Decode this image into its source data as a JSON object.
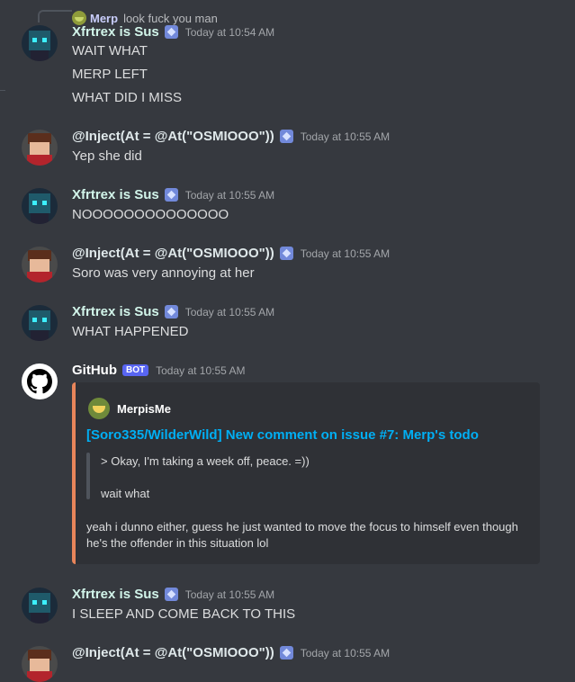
{
  "reply": {
    "author": "Merp",
    "text": "look fuck you man"
  },
  "messages": [
    {
      "author": "Xfrtrex is Sus",
      "time": "Today at 10:54 AM",
      "lines": [
        "WAIT WHAT",
        "MERP LEFT",
        "WHAT DID I MISS"
      ]
    },
    {
      "author": "@Inject(At = @At(\"OSMIOOO\"))",
      "time": "Today at 10:55 AM",
      "lines": [
        "Yep she did"
      ]
    },
    {
      "author": "Xfrtrex is Sus",
      "time": "Today at 10:55 AM",
      "lines": [
        "NOOOOOOOOOOOOOO"
      ]
    },
    {
      "author": "@Inject(At = @At(\"OSMIOOO\"))",
      "time": "Today at 10:55 AM",
      "lines": [
        "Soro was very annoying at her"
      ]
    },
    {
      "author": "Xfrtrex is Sus",
      "time": "Today at 10:55 AM",
      "lines": [
        "WHAT HAPPENED"
      ]
    },
    {
      "author": "GitHub",
      "badge": "BOT",
      "time": "Today at 10:55 AM"
    },
    {
      "author": "Xfrtrex is Sus",
      "time": "Today at 10:55 AM",
      "lines": [
        "I SLEEP AND COME BACK TO THIS"
      ]
    },
    {
      "author": "@Inject(At = @At(\"OSMIOOO\"))",
      "time": "Today at 10:55 AM"
    }
  ],
  "embed": {
    "author": "MerpisMe",
    "title": "[Soro335/WilderWild] New comment on issue #7: Merp's todo",
    "quote_lines": [
      "> Okay, I'm taking a week off, peace. =))",
      "wait what"
    ],
    "description": "yeah i dunno either, guess he just wanted to move the focus to himself even though he's the offender in this situation lol",
    "accent_color": "#e8855a"
  },
  "colors": {
    "background": "#36393f",
    "link": "#00aff4",
    "bot_badge": "#5865f2"
  }
}
